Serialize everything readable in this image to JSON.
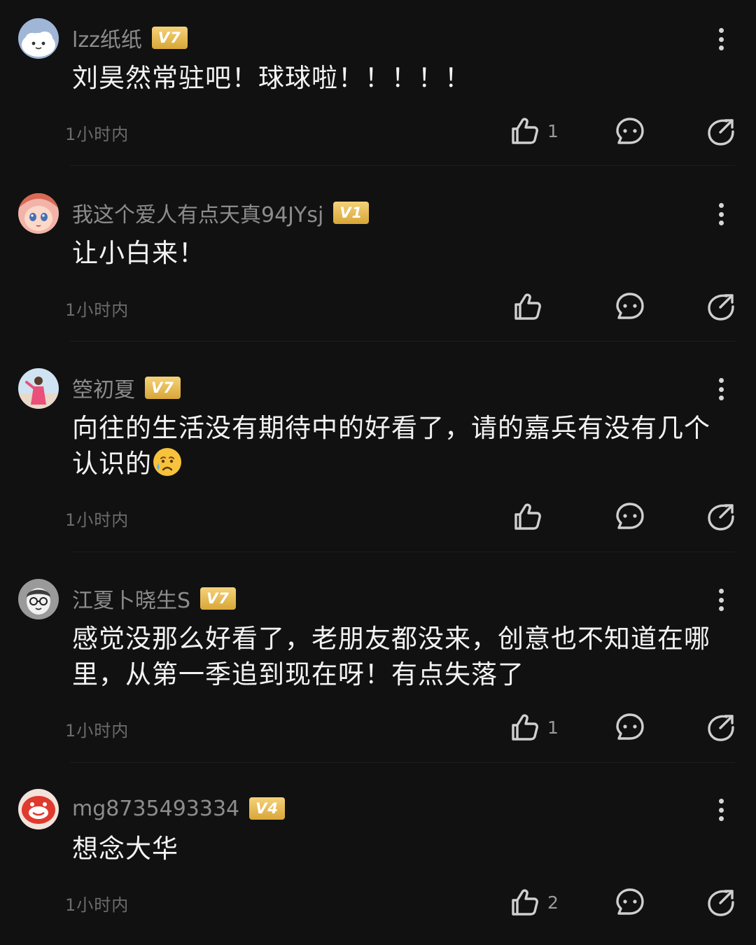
{
  "comments": [
    {
      "avatar": "avatar-cartoon-cloud",
      "username": "lzz纸纸",
      "level": "V7",
      "content": "刘昊然常驻吧！球球啦！！！！！",
      "time": "1小时内",
      "likes": "1"
    },
    {
      "avatar": "avatar-anime-girl",
      "username": "我这个爱人有点天真94JYsj",
      "level": "V1",
      "content": "让小白来！",
      "time": "1小时内",
      "likes": ""
    },
    {
      "avatar": "avatar-photo-beach",
      "username": "箜初夏",
      "level": "V7",
      "content": "向往的生活没有期待中的好看了，请的嘉兵有没有几个认识的",
      "emoji": "sad-tear-emoji",
      "time": "1小时内",
      "likes": ""
    },
    {
      "avatar": "avatar-glasses-face",
      "username": "江夏卜晓生S",
      "level": "V7",
      "content": "感觉没那么好看了，老朋友都没来，创意也不知道在哪里，从第一季追到现在呀！有点失落了",
      "time": "1小时内",
      "likes": "1"
    },
    {
      "avatar": "avatar-red-cartoon",
      "username": "mg8735493334",
      "level": "V4",
      "content": "想念大华",
      "time": "1小时内",
      "likes": "2"
    }
  ],
  "icons": {
    "like": "thumbs-up-icon",
    "reply": "comment-bubble-icon",
    "share": "share-arrow-icon",
    "more": "more-vertical-icon"
  },
  "colors": {
    "background": "#111111",
    "username": "#8c8c8c",
    "content": "#f3f3f3",
    "meta": "#6c6c6c",
    "badge": "#e4b84f"
  }
}
